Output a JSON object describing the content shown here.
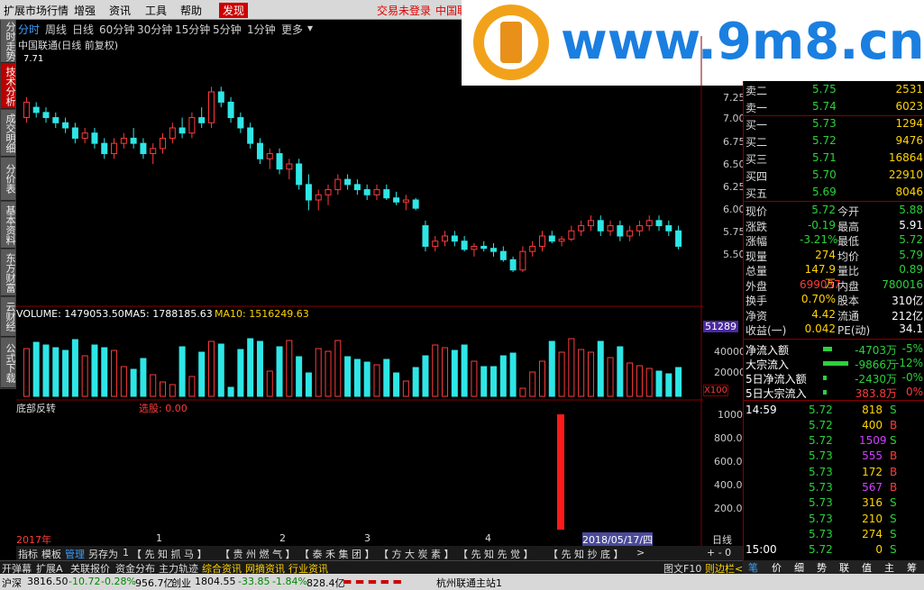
{
  "menu": {
    "items": [
      "扩展市场行情",
      "增强",
      "资讯",
      "工具",
      "帮助",
      "发现"
    ],
    "warn1": "交易未登录",
    "warn2": "中国联"
  },
  "periods": [
    "分时",
    "周线",
    "日线",
    "60分钟",
    "30分钟",
    "15分钟",
    "5分钟",
    "1分钟",
    "更多"
  ],
  "lefttabs": [
    "分时走势",
    "技术分析",
    "成交明细",
    "分价表",
    "基本资料",
    "东方财富",
    "云财经",
    "公式下载"
  ],
  "stock_title": "中国联通(日线 前复权)",
  "high_mark": "7.71",
  "vol_line": {
    "volume": "VOLUME: 1479053.50",
    "ma5": "MA5: 1788185.63",
    "ma10": "MA10: 1516249.63"
  },
  "vol_badge": "51289",
  "x100": "X100",
  "indicator": {
    "name": "底部反转",
    "xuangu": "选股: 0.00"
  },
  "price_axis": [
    "7.25",
    "7.00",
    "6.75",
    "6.50",
    "6.25",
    "6.00",
    "5.75",
    "5.50"
  ],
  "vol_axis": [
    "40000",
    "20000"
  ],
  "ind_axis": [
    "1000",
    "800.0",
    "600.0",
    "400.0",
    "200.0"
  ],
  "date_marks": [
    "2017年",
    "1",
    "2",
    "3",
    "4",
    "2018/05/17/四"
  ],
  "bottom_tabs": [
    "指标",
    "模板",
    "管理",
    "另存为",
    "1",
    "【 先 知 抓 马 】",
    "【 贵 州 燃 气 】",
    "【 泰 禾 集 团 】",
    "【 方 大 炭 素 】",
    "【 先 知 先 觉 】",
    "【 先 知 抄 底 】",
    ">"
  ],
  "rightarea": {
    "dayline": "日线",
    "zoom": "+ - 0"
  },
  "toolbar2": [
    "开弹幕",
    "扩展A",
    "关联报价",
    "资金分布",
    "主力轨迹",
    "综合资讯",
    "网摘资讯",
    "行业资讯"
  ],
  "toolbar2_right": [
    "图文F10",
    "则边栏<"
  ],
  "status": {
    "sh_label": "沪深",
    "sh": "3816.50",
    "sh_chg": "-10.72",
    "sh_pct": "-0.28%",
    "sh_amt": "956.7亿",
    "cy_label": "创业",
    "cy": "1804.55",
    "cy_chg": "-33.85",
    "cy_pct": "-1.84%",
    "cy_amt": "828.4亿",
    "server": "杭州联通主站1"
  },
  "logo_text": "www.9m8.cn",
  "orderbook": [
    {
      "name": "卖二",
      "price": "5.75",
      "vol": "2531"
    },
    {
      "name": "卖一",
      "price": "5.74",
      "vol": "6023"
    },
    {
      "name": "买一",
      "price": "5.73",
      "vol": "1294"
    },
    {
      "name": "买二",
      "price": "5.72",
      "vol": "9476"
    },
    {
      "name": "买三",
      "price": "5.71",
      "vol": "16864"
    },
    {
      "name": "买四",
      "price": "5.70",
      "vol": "22910"
    },
    {
      "name": "买五",
      "price": "5.69",
      "vol": "8046"
    }
  ],
  "quote": [
    {
      "a": "现价",
      "av": "5.72",
      "b": "今开",
      "bv": "5.88"
    },
    {
      "a": "涨跌",
      "av": "-0.19",
      "b": "最高",
      "bv": "5.91"
    },
    {
      "a": "涨幅",
      "av": "-3.21%",
      "b": "最低",
      "bv": "5.72"
    },
    {
      "a": "现量",
      "av": "274",
      "b": "均价",
      "bv": "5.79"
    },
    {
      "a": "总量",
      "av": "147.9万",
      "b": "量比",
      "bv": "0.89"
    },
    {
      "a": "外盘",
      "av": "699037",
      "b": "内盘",
      "bv": "780016"
    },
    {
      "a": "换手",
      "av": "0.70%",
      "b": "股本",
      "bv": "310亿"
    },
    {
      "a": "净资",
      "av": "4.42",
      "b": "流通",
      "bv": "212亿"
    },
    {
      "a": "收益(一)",
      "av": "0.042",
      "b": "PE(动)",
      "bv": "34.1"
    }
  ],
  "flows": [
    {
      "name": "净流入额",
      "val": "-4703万",
      "pct": "-5%"
    },
    {
      "name": "大宗流入",
      "val": "-9866万",
      "pct": "-12%"
    },
    {
      "name": "5日净流入额",
      "val": "-2430万",
      "pct": "-0%"
    },
    {
      "name": "5日大宗流入",
      "val": "383.8万",
      "pct": "0%"
    }
  ],
  "ticks": [
    {
      "t": "14:59",
      "p": "5.72",
      "v": "818",
      "d": "S"
    },
    {
      "t": "",
      "p": "5.72",
      "v": "400",
      "d": "B"
    },
    {
      "t": "",
      "p": "5.72",
      "v": "1509",
      "d": "S"
    },
    {
      "t": "",
      "p": "5.73",
      "v": "555",
      "d": "B"
    },
    {
      "t": "",
      "p": "5.73",
      "v": "172",
      "d": "B"
    },
    {
      "t": "",
      "p": "5.73",
      "v": "567",
      "d": "B"
    },
    {
      "t": "",
      "p": "5.73",
      "v": "316",
      "d": "S"
    },
    {
      "t": "",
      "p": "5.73",
      "v": "210",
      "d": "S"
    },
    {
      "t": "",
      "p": "5.73",
      "v": "274",
      "d": "S"
    },
    {
      "t": "15:00",
      "p": "5.72",
      "v": "0",
      "d": "S"
    }
  ],
  "righttabs": [
    "笔",
    "价",
    "细",
    "势",
    "联",
    "值",
    "主",
    "筹"
  ],
  "chart_data": {
    "type": "candlestick",
    "series_name": "中国联通",
    "y_range": [
      5.5,
      7.25
    ],
    "ohlc": [
      [
        7.0,
        7.2,
        6.95,
        7.15
      ],
      [
        7.1,
        7.15,
        7.0,
        7.05
      ],
      [
        7.05,
        7.1,
        6.95,
        7.0
      ],
      [
        7.0,
        7.05,
        6.9,
        6.95
      ],
      [
        6.95,
        7.0,
        6.85,
        6.9
      ],
      [
        6.9,
        6.95,
        6.75,
        6.8
      ],
      [
        6.8,
        6.9,
        6.75,
        6.85
      ],
      [
        6.85,
        6.9,
        6.7,
        6.75
      ],
      [
        6.75,
        6.8,
        6.6,
        6.65
      ],
      [
        6.65,
        6.8,
        6.6,
        6.75
      ],
      [
        6.75,
        6.85,
        6.7,
        6.8
      ],
      [
        6.8,
        6.9,
        6.7,
        6.75
      ],
      [
        6.75,
        6.8,
        6.6,
        6.65
      ],
      [
        6.65,
        6.75,
        6.55,
        6.7
      ],
      [
        6.7,
        6.85,
        6.65,
        6.8
      ],
      [
        6.8,
        6.95,
        6.75,
        6.9
      ],
      [
        6.9,
        7.0,
        6.8,
        6.85
      ],
      [
        6.85,
        7.05,
        6.8,
        7.0
      ],
      [
        7.0,
        7.1,
        6.9,
        6.95
      ],
      [
        6.95,
        7.3,
        6.9,
        7.25
      ],
      [
        7.25,
        7.3,
        7.1,
        7.15
      ],
      [
        7.15,
        7.2,
        6.95,
        7.0
      ],
      [
        7.0,
        7.05,
        6.85,
        6.9
      ],
      [
        6.9,
        6.95,
        6.7,
        6.75
      ],
      [
        6.75,
        6.8,
        6.55,
        6.6
      ],
      [
        6.6,
        6.7,
        6.5,
        6.65
      ],
      [
        6.65,
        6.7,
        6.45,
        6.5
      ],
      [
        6.5,
        6.6,
        6.4,
        6.55
      ],
      [
        6.55,
        6.6,
        6.3,
        6.35
      ],
      [
        6.35,
        6.45,
        6.1,
        6.2
      ],
      [
        6.2,
        6.3,
        6.1,
        6.25
      ],
      [
        6.25,
        6.35,
        6.15,
        6.3
      ],
      [
        6.3,
        6.45,
        6.25,
        6.4
      ],
      [
        6.4,
        6.45,
        6.3,
        6.35
      ],
      [
        6.35,
        6.4,
        6.25,
        6.3
      ],
      [
        6.3,
        6.35,
        6.2,
        6.25
      ],
      [
        6.25,
        6.35,
        6.2,
        6.3
      ],
      [
        6.3,
        6.35,
        6.2,
        6.22
      ],
      [
        6.22,
        6.28,
        6.15,
        6.18
      ],
      [
        6.18,
        6.25,
        6.1,
        6.2
      ],
      [
        6.2,
        6.22,
        6.1,
        6.12
      ],
      [
        5.95,
        6.0,
        5.7,
        5.75
      ],
      [
        5.75,
        5.85,
        5.7,
        5.8
      ],
      [
        5.8,
        5.9,
        5.75,
        5.85
      ],
      [
        5.85,
        5.9,
        5.75,
        5.8
      ],
      [
        5.8,
        5.85,
        5.7,
        5.72
      ],
      [
        5.72,
        5.78,
        5.65,
        5.75
      ],
      [
        5.75,
        5.8,
        5.7,
        5.73
      ],
      [
        5.73,
        5.78,
        5.65,
        5.7
      ],
      [
        5.7,
        5.75,
        5.6,
        5.62
      ],
      [
        5.62,
        5.65,
        5.5,
        5.52
      ],
      [
        5.52,
        5.75,
        5.5,
        5.7
      ],
      [
        5.7,
        5.8,
        5.65,
        5.75
      ],
      [
        5.75,
        5.9,
        5.7,
        5.85
      ],
      [
        5.85,
        5.9,
        5.78,
        5.8
      ],
      [
        5.8,
        5.85,
        5.75,
        5.82
      ],
      [
        5.82,
        5.95,
        5.8,
        5.9
      ],
      [
        5.9,
        6.0,
        5.85,
        5.95
      ],
      [
        5.95,
        6.05,
        5.9,
        6.0
      ],
      [
        6.0,
        6.05,
        5.85,
        5.9
      ],
      [
        5.9,
        6.0,
        5.85,
        5.95
      ],
      [
        5.95,
        6.0,
        5.8,
        5.85
      ],
      [
        5.85,
        5.95,
        5.8,
        5.9
      ],
      [
        5.9,
        6.0,
        5.85,
        5.95
      ],
      [
        5.95,
        6.05,
        5.9,
        6.0
      ],
      [
        6.0,
        6.05,
        5.9,
        5.95
      ],
      [
        5.95,
        6.0,
        5.85,
        5.9
      ],
      [
        5.9,
        5.95,
        5.72,
        5.75
      ]
    ]
  }
}
